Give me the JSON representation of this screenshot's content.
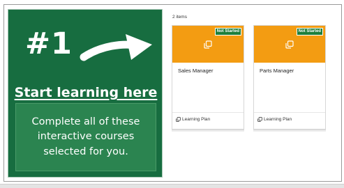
{
  "promo": {
    "number": "#1",
    "link_text": "Start learning here",
    "description": "Complete all of these interactive courses selected for you."
  },
  "items": {
    "count_label": "2 items",
    "cards": [
      {
        "title": "Sales Manager",
        "status": "Not Started",
        "type_label": "Learning Plan",
        "icon": "learning-plan-icon"
      },
      {
        "title": "Parts Manager",
        "status": "Not Started",
        "type_label": "Learning Plan",
        "icon": "learning-plan-icon"
      }
    ]
  },
  "colors": {
    "promo_bg": "#176d40",
    "promo_box_bg": "#2b8450",
    "card_cover": "#f39c12",
    "badge_bg": "#1d7f3c"
  }
}
